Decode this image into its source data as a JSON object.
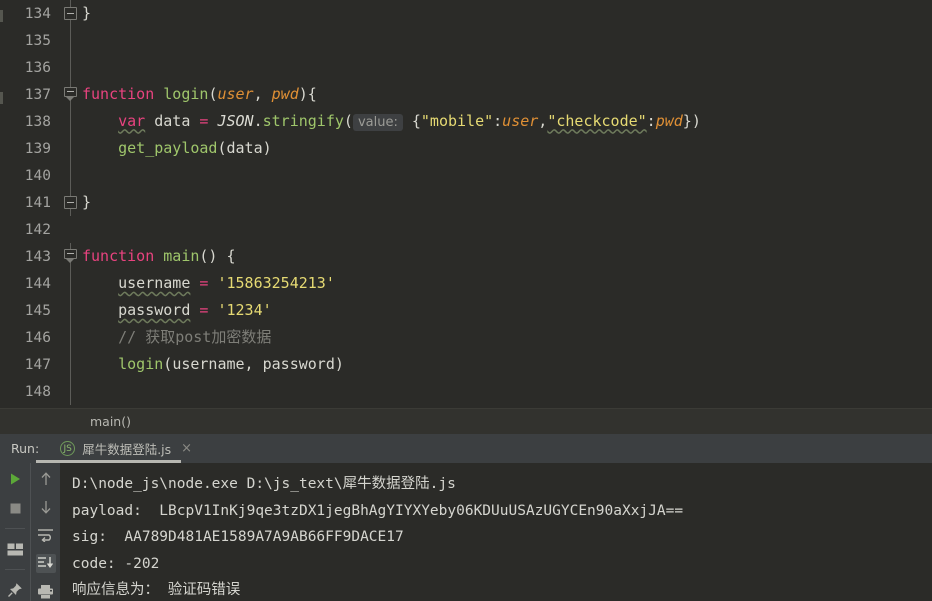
{
  "editor": {
    "lines": [
      {
        "num": "134",
        "fold": "box",
        "guide": true,
        "indent": 0,
        "tokens": [
          {
            "t": "}",
            "c": "pn"
          }
        ]
      },
      {
        "num": "135",
        "fold": "none",
        "guide": true,
        "indent": 0,
        "tokens": []
      },
      {
        "num": "136",
        "fold": "none",
        "guide": true,
        "indent": 0,
        "tokens": []
      },
      {
        "num": "137",
        "fold": "arrow",
        "guide": true,
        "indent": 0,
        "tokens": [
          {
            "t": "function",
            "c": "k"
          },
          {
            "t": " ",
            "c": "pl"
          },
          {
            "t": "login",
            "c": "fn"
          },
          {
            "t": "(",
            "c": "pn"
          },
          {
            "t": "user",
            "c": "pm"
          },
          {
            "t": ", ",
            "c": "pn"
          },
          {
            "t": "pwd",
            "c": "pm"
          },
          {
            "t": "){",
            "c": "pn"
          }
        ]
      },
      {
        "num": "138",
        "fold": "none",
        "guide": true,
        "indent": 0,
        "tokens": [
          {
            "t": "    ",
            "c": "pl"
          },
          {
            "t": "var",
            "c": "k sq"
          },
          {
            "t": " ",
            "c": "pl"
          },
          {
            "t": "data",
            "c": "pl"
          },
          {
            "t": " ",
            "c": "pl"
          },
          {
            "t": "=",
            "c": "k"
          },
          {
            "t": " ",
            "c": "pl"
          },
          {
            "t": "JSON",
            "c": "ob"
          },
          {
            "t": ".",
            "c": "pn"
          },
          {
            "t": "stringify",
            "c": "fn"
          },
          {
            "t": "(",
            "c": "pn"
          },
          {
            "t": "value:",
            "c": "hint"
          },
          {
            "t": " ",
            "c": "pl"
          },
          {
            "t": "{",
            "c": "pn"
          },
          {
            "t": "\"mobile\"",
            "c": "st"
          },
          {
            "t": ":",
            "c": "pn"
          },
          {
            "t": "user",
            "c": "pm"
          },
          {
            "t": ",",
            "c": "pn"
          },
          {
            "t": "\"checkcode\"",
            "c": "st sq"
          },
          {
            "t": ":",
            "c": "pn"
          },
          {
            "t": "pwd",
            "c": "pm"
          },
          {
            "t": "})",
            "c": "pn"
          }
        ]
      },
      {
        "num": "139",
        "fold": "none",
        "guide": true,
        "indent": 0,
        "tokens": [
          {
            "t": "    ",
            "c": "pl"
          },
          {
            "t": "get_payload",
            "c": "fn"
          },
          {
            "t": "(",
            "c": "pn"
          },
          {
            "t": "data",
            "c": "pl"
          },
          {
            "t": ")",
            "c": "pn"
          }
        ]
      },
      {
        "num": "140",
        "fold": "none",
        "guide": true,
        "indent": 0,
        "tokens": []
      },
      {
        "num": "141",
        "fold": "box",
        "guide": true,
        "indent": 0,
        "tokens": [
          {
            "t": "}",
            "c": "pn"
          }
        ]
      },
      {
        "num": "142",
        "fold": "none",
        "guide": false,
        "indent": 0,
        "tokens": []
      },
      {
        "num": "143",
        "fold": "arrow",
        "guide": true,
        "indent": 0,
        "tokens": [
          {
            "t": "function",
            "c": "k"
          },
          {
            "t": " ",
            "c": "pl"
          },
          {
            "t": "main",
            "c": "fn"
          },
          {
            "t": "() {",
            "c": "pn"
          }
        ]
      },
      {
        "num": "144",
        "fold": "none",
        "guide": true,
        "indent": 0,
        "tokens": [
          {
            "t": "    ",
            "c": "pl"
          },
          {
            "t": "username",
            "c": "pl sq"
          },
          {
            "t": " ",
            "c": "pl"
          },
          {
            "t": "=",
            "c": "k"
          },
          {
            "t": " ",
            "c": "pl"
          },
          {
            "t": "'15863254213'",
            "c": "st"
          }
        ]
      },
      {
        "num": "145",
        "fold": "none",
        "guide": true,
        "indent": 0,
        "tokens": [
          {
            "t": "    ",
            "c": "pl"
          },
          {
            "t": "password",
            "c": "pl sq"
          },
          {
            "t": " ",
            "c": "pl"
          },
          {
            "t": "=",
            "c": "k"
          },
          {
            "t": " ",
            "c": "pl"
          },
          {
            "t": "'1234'",
            "c": "st"
          }
        ]
      },
      {
        "num": "146",
        "fold": "none",
        "guide": true,
        "indent": 0,
        "tokens": [
          {
            "t": "    ",
            "c": "pl"
          },
          {
            "t": "// 获取post加密数据",
            "c": "cm"
          }
        ]
      },
      {
        "num": "147",
        "fold": "none",
        "guide": true,
        "indent": 0,
        "tokens": [
          {
            "t": "    ",
            "c": "pl"
          },
          {
            "t": "login",
            "c": "fn"
          },
          {
            "t": "(",
            "c": "pn"
          },
          {
            "t": "username, password",
            "c": "pl"
          },
          {
            "t": ")",
            "c": "pn"
          }
        ]
      },
      {
        "num": "148",
        "fold": "none",
        "guide": true,
        "indent": 0,
        "tokens": []
      }
    ]
  },
  "breadcrumb": {
    "path": "main()"
  },
  "run_panel": {
    "label": "Run:",
    "tab_name": "犀牛数据登陆.js",
    "tab_icon": "nodejs-icon",
    "close": "×"
  },
  "toolbar": {
    "left": [
      {
        "name": "rerun-button",
        "icon": "play-icon"
      },
      {
        "name": "stop-button",
        "icon": "stop-icon"
      },
      {
        "name": "console-layout-button",
        "icon": "layout-icon"
      },
      {
        "name": "pin-button",
        "icon": "pin-icon"
      }
    ],
    "right": [
      {
        "name": "up-button",
        "icon": "arrow-up-icon"
      },
      {
        "name": "down-button",
        "icon": "arrow-down-icon"
      },
      {
        "name": "soft-wrap-button",
        "icon": "wrap-icon"
      },
      {
        "name": "scroll-to-end-button",
        "icon": "scroll-end-icon",
        "selected": true
      },
      {
        "name": "print-button",
        "icon": "printer-icon"
      }
    ]
  },
  "console": {
    "lines": [
      "D:\\node_js\\node.exe D:\\js_text\\犀牛数据登陆.js",
      "payload:  LBcpV1InKj9qe3tzDX1jegBhAgYIYXYeby06KDUuUSAzUGYCEn90aXxjJA==",
      "sig:  AA789D481AE1589A7A9AB66FF9DACE17",
      "code: -202",
      "响应信息为： 验证码错误"
    ]
  },
  "colors": {
    "editor_bg": "#2b2b28",
    "panel_bg": "#3c3f41",
    "breadcrumb_bg": "#32322e",
    "keyword": "#e8437f",
    "function": "#9fc66b",
    "param": "#e09035",
    "string": "#e6da73",
    "comment": "#7e7e78",
    "text": "#d8d8d0",
    "play_green": "#5ca838"
  }
}
